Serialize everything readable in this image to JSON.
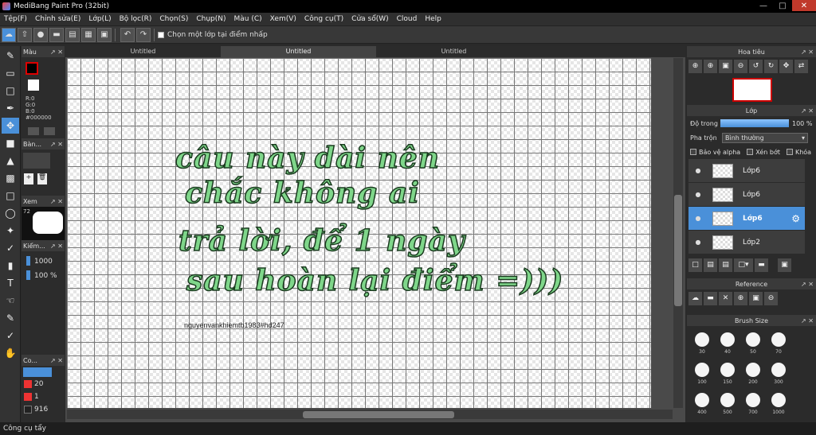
{
  "app": {
    "title": "MediBang Paint Pro (32bit)"
  },
  "menu": [
    "Tệp(F)",
    "Chỉnh sửa(E)",
    "Lớp(L)",
    "Bộ lọc(R)",
    "Chọn(S)",
    "Chụp(N)",
    "Màu (C)",
    "Xem(V)",
    "Công cụ(T)",
    "Cửa sổ(W)",
    "Cloud",
    "Help"
  ],
  "toolbar": {
    "select_layer_label": "Chọn một lớp tại điểm nhấp"
  },
  "tabs": [
    "Untitled",
    "Untitled",
    "Untitled"
  ],
  "color_panel": {
    "title": "Màu",
    "r": "R:0",
    "g": "G:0",
    "b": "B:0",
    "hex": "#000000"
  },
  "panels": {
    "brush": "Bàn...",
    "view": "Xem",
    "view_zoom": "72",
    "check": "Kiểm...",
    "check_v1": "1000",
    "check_v2": "100 %",
    "color2": "Co..."
  },
  "brush_list": [
    "20",
    "1",
    "916"
  ],
  "canvas_text": [
    "câu này dài nên",
    "chắc không ai",
    "trả lời, để 1 ngày",
    "sau hoàn lại điểm =)))"
  ],
  "signature": "nguyenvankhiemtb1983#hd247",
  "navigator": {
    "title": "Hoa tiêu"
  },
  "layer_panel": {
    "title": "Lớp",
    "opacity_label": "Độ trong",
    "opacity_value": "100 %",
    "opacity": 1.0,
    "blend_label": "Pha trộn",
    "blend_value": "Bình thường",
    "alpha_protect": "Bảo vệ alpha",
    "clip": "Xén bớt",
    "lock": "Khóa"
  },
  "layers": [
    {
      "name": "Lớp6",
      "selected": false
    },
    {
      "name": "Lớp6",
      "selected": false
    },
    {
      "name": "Lớp6",
      "selected": true
    },
    {
      "name": "Lớp2",
      "selected": false
    }
  ],
  "reference": {
    "title": "Reference"
  },
  "brush_size": {
    "title": "Brush Size",
    "sizes": [
      "30",
      "40",
      "50",
      "70",
      "100",
      "150",
      "200",
      "300",
      "400",
      "500",
      "700",
      "1000"
    ]
  },
  "status": "Công cụ tẩy",
  "colors": {
    "accent": "#4a90d9",
    "text_fill": "#7fd68a",
    "close": "#c0392b"
  }
}
